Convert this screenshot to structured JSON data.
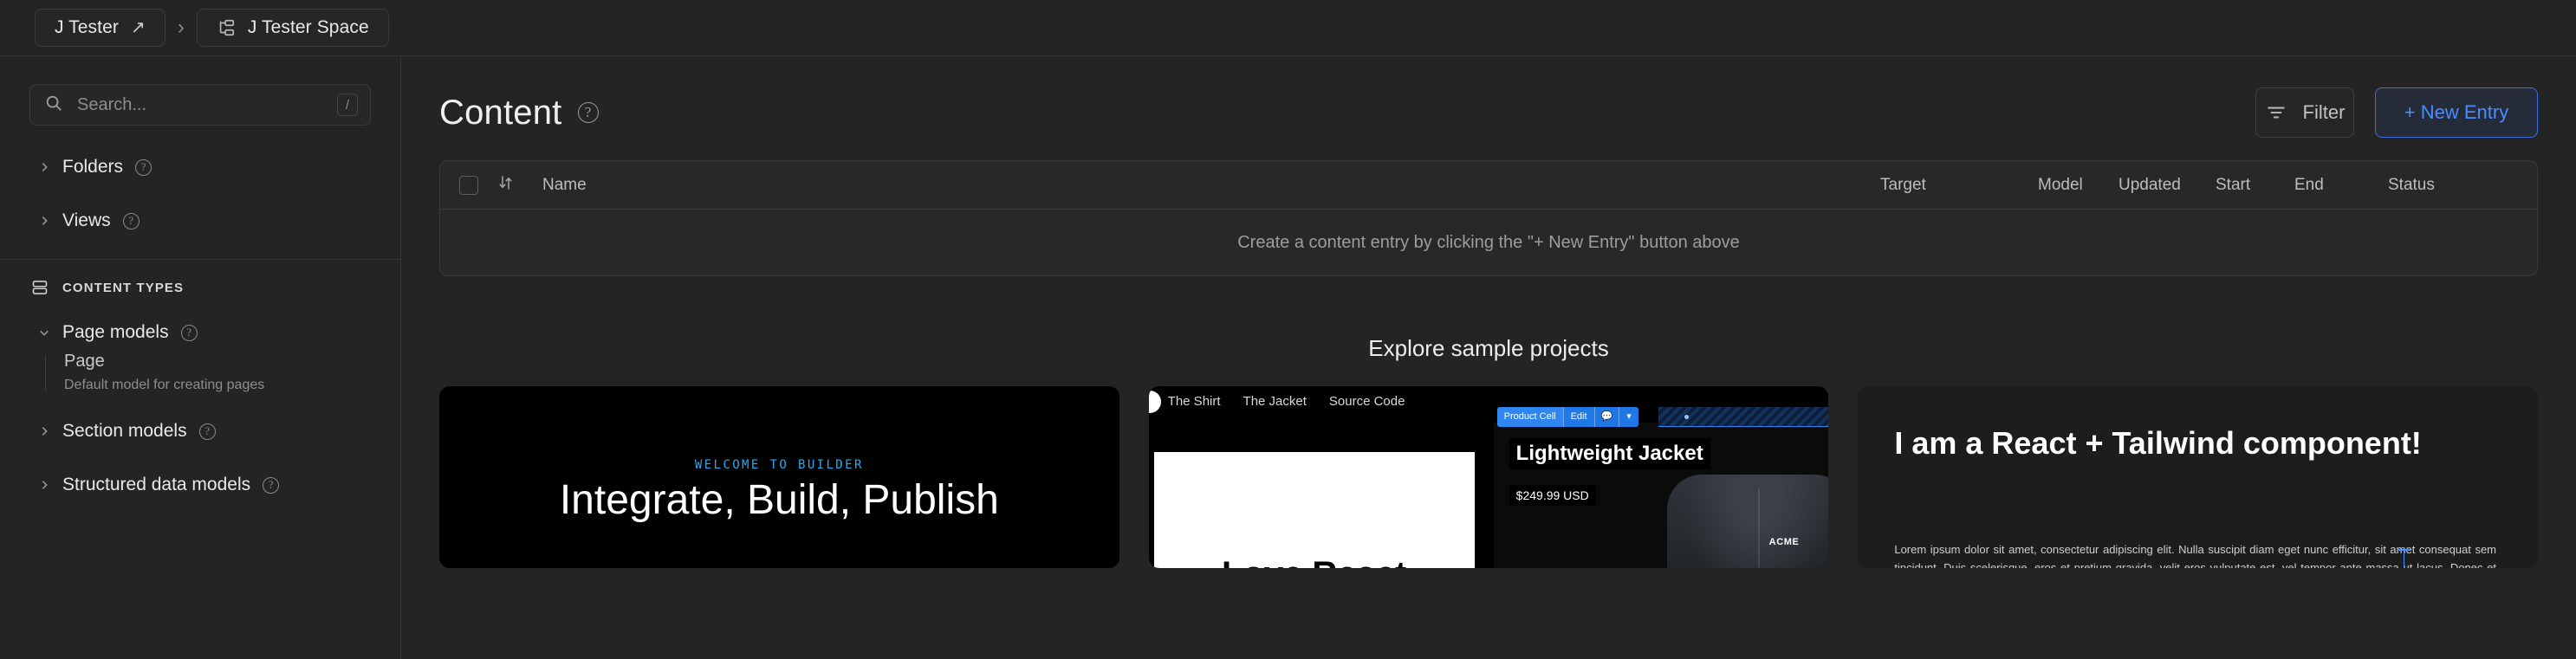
{
  "breadcrumb": {
    "org_label": "J Tester",
    "org_external_icon": "arrow-up-right-icon",
    "separator": "›",
    "space_icon": "sitemap-icon",
    "space_label": "J Tester Space"
  },
  "sidebar": {
    "search": {
      "placeholder": "Search...",
      "value": "",
      "shortcut": "/",
      "icon": "search-icon"
    },
    "nav": [
      {
        "label": "Folders",
        "expanded": false,
        "help": "?"
      },
      {
        "label": "Views",
        "expanded": false,
        "help": "?"
      }
    ],
    "section": {
      "icon": "stack-icon",
      "label": "CONTENT TYPES"
    },
    "models": [
      {
        "label": "Page models",
        "expanded": true,
        "help": "?",
        "children": [
          {
            "title": "Page",
            "subtitle": "Default model for creating pages"
          }
        ]
      },
      {
        "label": "Section models",
        "expanded": false,
        "help": "?",
        "children": []
      },
      {
        "label": "Structured data models",
        "expanded": false,
        "help": "?",
        "children": []
      }
    ]
  },
  "main": {
    "title": "Content",
    "title_help": "?",
    "filter_button": {
      "label": "Filter",
      "icon": "filter-icon"
    },
    "new_entry_button": {
      "label": "+ New Entry",
      "accent": "#4c8dff"
    },
    "table": {
      "select_all_checked": false,
      "sort_icon": "sort-arrows-icon",
      "columns": [
        {
          "key": "name",
          "label": "Name"
        },
        {
          "key": "target",
          "label": "Target"
        },
        {
          "key": "model",
          "label": "Model"
        },
        {
          "key": "updated",
          "label": "Updated"
        },
        {
          "key": "start",
          "label": "Start"
        },
        {
          "key": "end",
          "label": "End"
        },
        {
          "key": "status",
          "label": "Status"
        }
      ],
      "rows": [],
      "empty_message": "Create a content entry by clicking the \"+ New Entry\" button above"
    },
    "samples": {
      "heading": "Explore sample projects",
      "cards": [
        {
          "id": "builder-landing",
          "eyebrow": "WELCOME TO BUILDER",
          "headline": "Integrate, Build, Publish"
        },
        {
          "id": "ecommerce-storefront",
          "nav": [
            "The Shirt",
            "The Jacket",
            "Source Code"
          ],
          "panel_headline": "Love React",
          "toolbar": {
            "label": "Product Cell",
            "edit": "Edit",
            "comment_icon": "comment-icon",
            "chevron_icon": "chevron-down-icon"
          },
          "product_title": "Lightweight Jacket",
          "product_price": "$249.99 USD",
          "brand": "ACME"
        },
        {
          "id": "react-tailwind-component",
          "headline": "I am a React + Tailwind component!",
          "body": "Lorem ipsum dolor sit amet, consectetur adipiscing elit. Nulla suscipit diam eget nunc efficitur, sit amet consequat sem tincidunt. Duis scelerisque, eros et pretium gravida, velit eros vulputate est, vel tempor ante massa ut lacus. Donec et aliquet quam, at convallis odio. Proin libero est, viverra eu nisl id, commodo elementum metus."
        }
      ]
    }
  }
}
